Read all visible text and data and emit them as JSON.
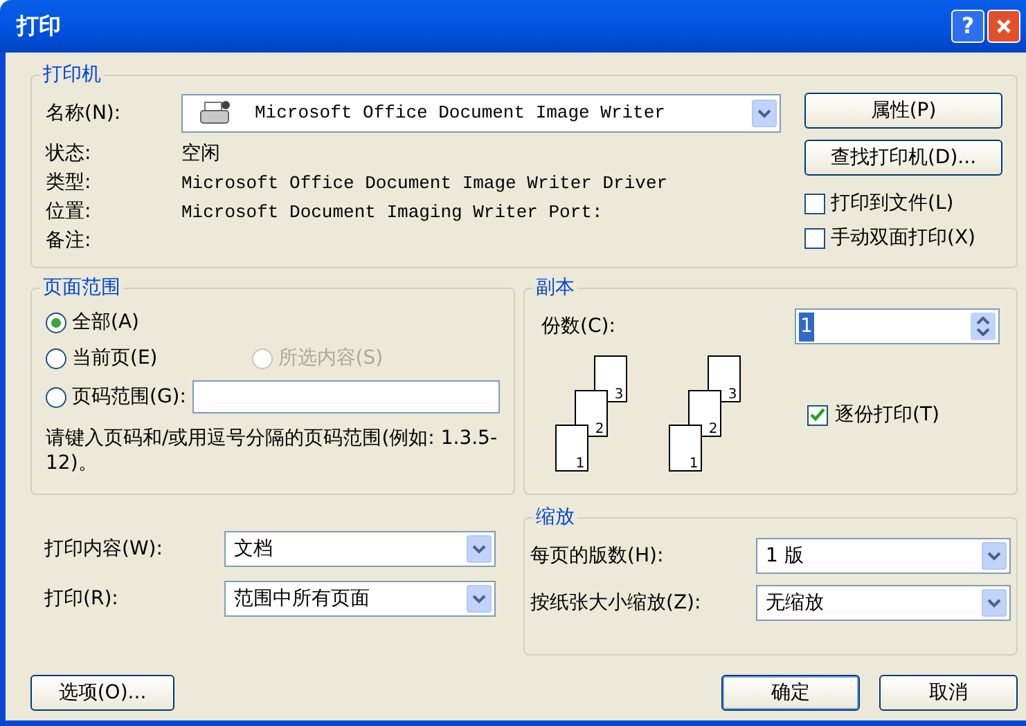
{
  "window": {
    "title": "打印",
    "help_button": "?"
  },
  "printer": {
    "title": "打印机",
    "name_label": "名称(N):",
    "name_value": "Microsoft Office Document Image Writer",
    "properties_button": "属性(P)",
    "find_button": "查找打印机(D)...",
    "info": [
      {
        "label": "状态:",
        "value": "空闲"
      },
      {
        "label": "类型:",
        "value": "Microsoft Office Document Image Writer Driver"
      },
      {
        "label": "位置:",
        "value": "Microsoft Document Imaging Writer Port:"
      },
      {
        "label": "备注:"
      }
    ],
    "checkboxes": [
      {
        "label": "打印到文件(L)",
        "checked": false
      },
      {
        "label": "手动双面打印(X)",
        "checked": false
      }
    ]
  },
  "page_range": {
    "title": "页面范围",
    "options": [
      {
        "label": "全部(A)",
        "selected": true,
        "disabled": false
      },
      {
        "label": "当前页(E)",
        "selected": false,
        "disabled": false
      },
      {
        "label": "所选内容(S)",
        "selected": false,
        "disabled": true
      },
      {
        "label": "页码范围(G):",
        "selected": false,
        "disabled": false
      }
    ],
    "hint": "请键入页码和/或用逗号分隔的页码范围(例如: 1.3.5-12)。"
  },
  "copies": {
    "title": "副本",
    "count_label": "份数(C):",
    "count_value": "1",
    "stacks": [
      [
        "3",
        "2",
        "1"
      ],
      [
        "3",
        "2",
        "1"
      ]
    ],
    "collate": {
      "label": "逐份打印(T)",
      "checked": true
    }
  },
  "print_what": {
    "label": "打印内容(W):",
    "value": "文档"
  },
  "print": {
    "label": "打印(R):",
    "value": "范围中所有页面"
  },
  "zoom": {
    "title": "缩放",
    "rows": [
      {
        "label": "每页的版数(H):",
        "value": "1 版"
      },
      {
        "label": "按纸张大小缩放(Z):",
        "value": "无缩放"
      }
    ]
  },
  "buttons": {
    "options": "选项(O)...",
    "ok": "确定",
    "cancel": "取消"
  }
}
